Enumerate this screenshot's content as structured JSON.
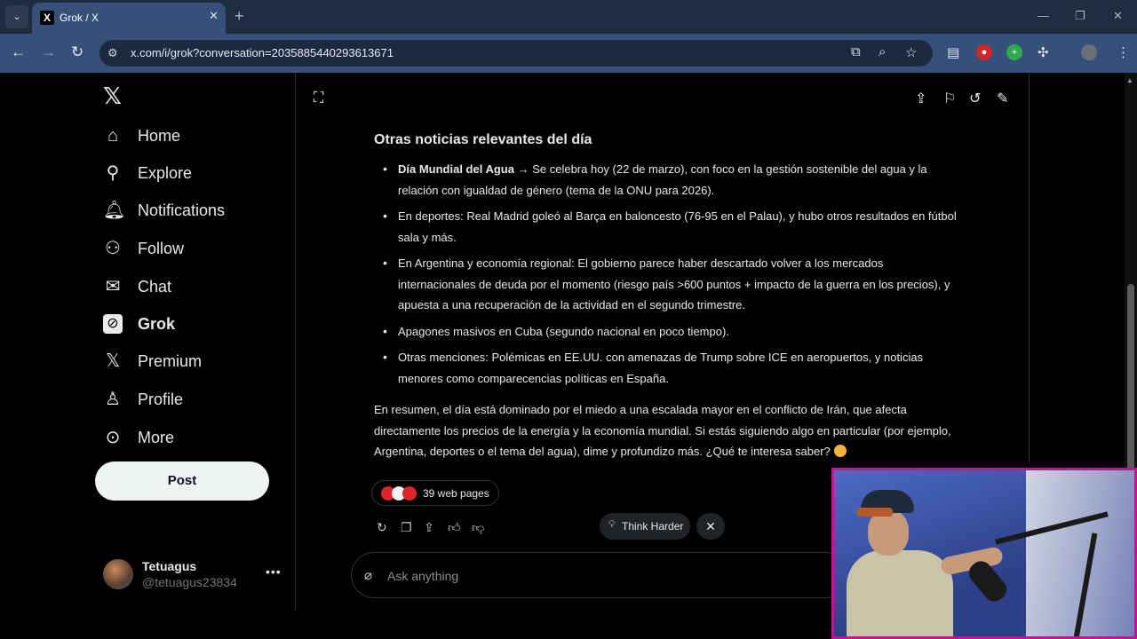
{
  "browser": {
    "tab_title": "Grok / X",
    "url": "x.com/i/grok?conversation=2035885440293613671"
  },
  "sidebar": {
    "items": [
      {
        "label": "Home",
        "icon": "home-icon"
      },
      {
        "label": "Explore",
        "icon": "search-icon"
      },
      {
        "label": "Notifications",
        "icon": "bell-icon"
      },
      {
        "label": "Follow",
        "icon": "person-plus-icon"
      },
      {
        "label": "Chat",
        "icon": "mail-icon"
      },
      {
        "label": "Grok",
        "icon": "grok-icon",
        "active": true
      },
      {
        "label": "Premium",
        "icon": "x-icon"
      },
      {
        "label": "Profile",
        "icon": "person-icon"
      },
      {
        "label": "More",
        "icon": "more-circle-icon"
      }
    ],
    "post_label": "Post",
    "account": {
      "name": "Tetuagus",
      "handle": "@tetuagus23834"
    }
  },
  "conversation": {
    "heading": "Otras noticias relevantes del día",
    "bullets": [
      {
        "bold": "Día Mundial del Agua",
        "text": " → Se celebra hoy (22 de marzo), con foco en la gestión sostenible del agua y la relación con igualdad de género (tema de la ONU para 2026)."
      },
      {
        "bold": "",
        "text": "En deportes: Real Madrid goleó al Barça en baloncesto (76-95 en el Palau), y hubo otros resultados en fútbol sala y más."
      },
      {
        "bold": "",
        "text": "En Argentina y economía regional: El gobierno parece haber descartado volver a los mercados internacionales de deuda por el momento (riesgo país >600 puntos + impacto de la guerra en los precios), y apuesta a una recuperación de la actividad en el segundo trimestre."
      },
      {
        "bold": "",
        "text": "Apagones masivos en Cuba (segundo nacional en poco tiempo)."
      },
      {
        "bold": "",
        "text": "Otras menciones: Polémicas en EE.UU. con amenazas de Trump sobre ICE en aeropuertos, y noticias menores como comparecencias políticas en España."
      }
    ],
    "summary": "En resumen, el día está dominado por el miedo a una escalada mayor en el conflicto de Irán, que afecta directamente los precios de la energía y la economía mundial. Si estás siguiendo algo en particular (por ejemplo, Argentina, deportes o el tema del agua), dime y profundizo más. ¿Qué te interesa saber?",
    "sources_label": "39 web pages",
    "think_harder_label": "Think Harder",
    "ask_placeholder": "Ask anything"
  },
  "colors": {
    "accent_border": "#c01690",
    "tab_active": "#35517a",
    "post_button": "#eff3f4"
  }
}
